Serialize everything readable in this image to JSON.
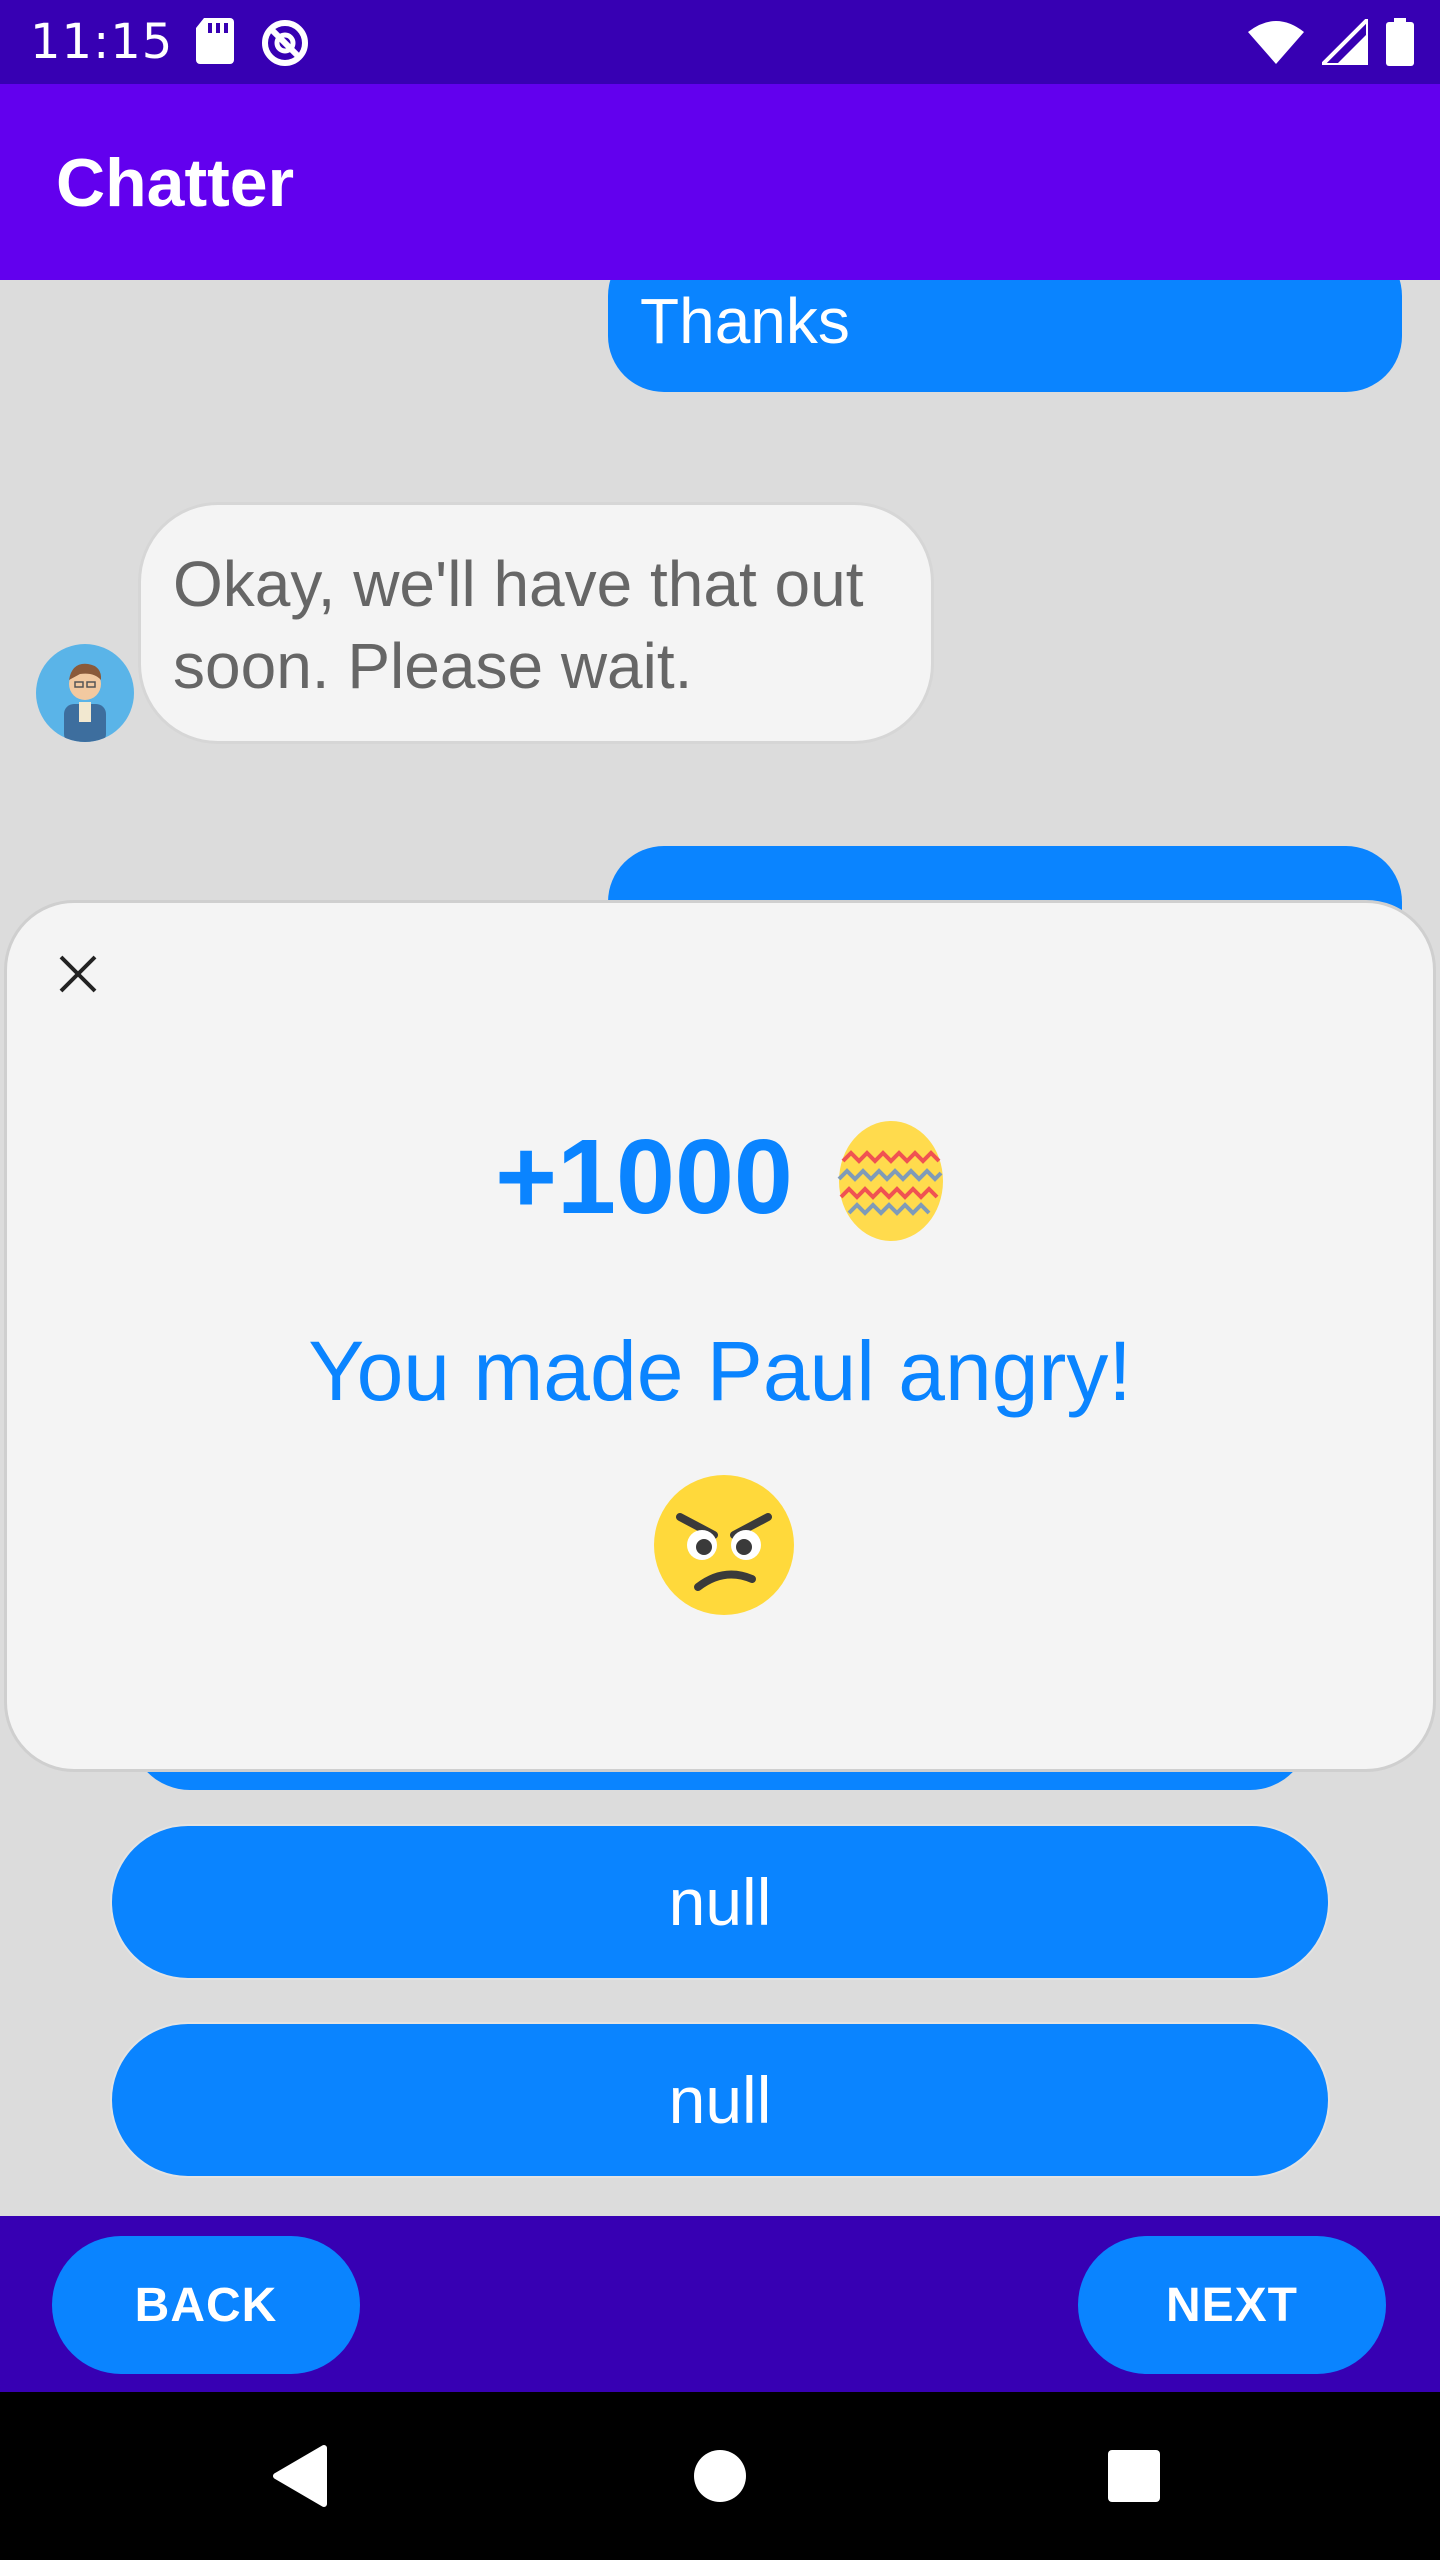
{
  "status_bar": {
    "time": "11:15",
    "icons_left": [
      "sd-card-icon",
      "do-not-disturb-icon"
    ],
    "icons_right": [
      "wifi-icon",
      "cell-signal-icon",
      "battery-icon"
    ]
  },
  "app_bar": {
    "title": "Chatter"
  },
  "chat": {
    "messages": [
      {
        "from": "user",
        "text": "Thanks"
      },
      {
        "from": "bot",
        "text": "Okay, we'll have that out soon. Please wait."
      }
    ],
    "choices": [
      {
        "label": "null"
      },
      {
        "label": "null"
      }
    ]
  },
  "dialog": {
    "points": "+1000",
    "points_icon": "easter-egg-icon",
    "message": "You made Paul angry!",
    "emoji": "angry-face-icon"
  },
  "bottom_nav": {
    "back_label": "BACK",
    "next_label": "NEXT"
  },
  "system_nav": {
    "buttons": [
      "back-triangle-icon",
      "home-circle-icon",
      "recents-square-icon"
    ]
  },
  "colors": {
    "accent": "#0a84ff",
    "primary": "#6200ee",
    "primary_dark": "#3700b3"
  }
}
